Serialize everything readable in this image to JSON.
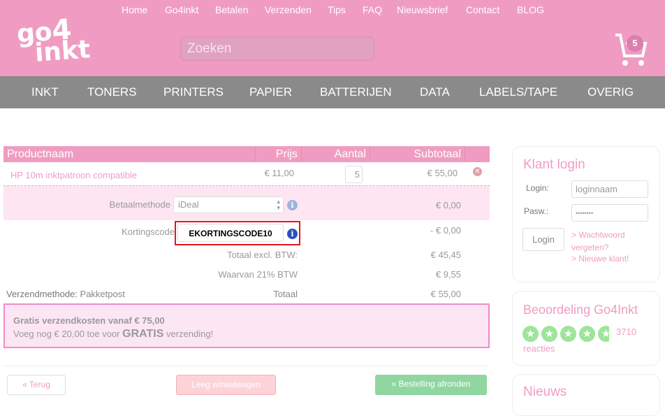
{
  "header": {
    "top_links": [
      "Home",
      "Go4inkt",
      "Betalen",
      "Verzenden",
      "Tips",
      "FAQ",
      "Nieuwsbrief",
      "Contact",
      "BLOG"
    ],
    "logo": "go4inkt",
    "search_placeholder": "Zoeken",
    "cart_count": "5"
  },
  "nav": [
    "INKT",
    "TONERS",
    "PRINTERS",
    "PAPIER",
    "BATTERIJEN",
    "DATA",
    "LABELS/TAPE",
    "OVERIG"
  ],
  "cart": {
    "columns": [
      "Productnaam",
      "Prijs",
      "Aantal",
      "Subtotaal"
    ],
    "items": [
      {
        "name": "HP 10m inktpatroon compatible",
        "price": "€ 11,00",
        "qty": "5",
        "subtotal": "€ 55,00"
      }
    ],
    "payment_label": "Betaalmethode",
    "payment_value": "iDeal",
    "payment_cost": "€ 0,00",
    "discount_label": "Kortingscode",
    "discount_value": "EKORTINGSCODE10",
    "discount_amount": "- € 0,00",
    "excl_label": "Totaal excl. BTW:",
    "excl_value": "€ 45,45",
    "vat_label": "Waarvan 21% BTW",
    "vat_value": "€ 9,55",
    "shipping_label": "Verzendmethode:",
    "shipping_value": "Pakketpost",
    "total_label": "Totaal",
    "total_value": "€ 55,00",
    "notice_line1": "Gratis verzendkosten vanaf € 75,00",
    "notice_pre": "Voeg nog € 20,00 toe voor",
    "notice_bold": "GRATIS",
    "notice_post": "verzending!",
    "back": "« Terug",
    "empty": "Leeg winkelwagen",
    "checkout": "» Bestelling afronden"
  },
  "sidebar": {
    "login_title": "Klant login",
    "login_label": "Login:",
    "login_placeholder": "loginnaam",
    "pass_label": "Pasw.:",
    "pass_value": "••••••••",
    "login_button": "Login",
    "forgot": "> Wachtwoord vergeten?",
    "new": "> Nieuwe klant!",
    "rating_title": "Beoordeling Go4Inkt",
    "rating_count": "3710",
    "rating_suffix": "reacties",
    "rating_stars": 4.6,
    "news_title": "Nieuws"
  },
  "colors": {
    "brand": "#f09cc2",
    "nav": "#8a8a8a",
    "highlight": "#e8141b",
    "success": "#8fd6a0"
  }
}
